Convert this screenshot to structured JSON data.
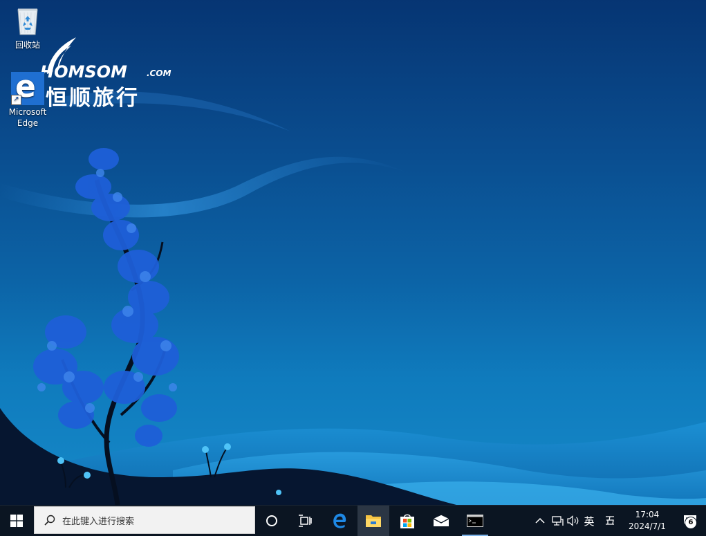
{
  "desktop": {
    "icons": [
      {
        "label": "回收站",
        "icon": "recycle-bin-icon"
      },
      {
        "label": "Microsoft Edge",
        "label_line1": "Microsoft",
        "label_line2": "Edge",
        "icon": "edge-icon"
      }
    ]
  },
  "wallpaper": {
    "brand_en": "HOMSOM",
    "brand_com": ".COM",
    "brand_cn": "恒顺旅行"
  },
  "taskbar": {
    "search_placeholder": "在此键入进行搜索",
    "pinned": [
      "cortana-icon",
      "task-view-icon",
      "edge-icon",
      "file-explorer-icon",
      "store-icon",
      "mail-icon",
      "command-prompt-icon"
    ],
    "active_app": "command-prompt-icon",
    "tray": {
      "language": "英",
      "ime_icon": "ime-mode-icon",
      "time": "17:04",
      "date": "2024/7/1",
      "notification_count": "6"
    }
  },
  "colors": {
    "taskbar_bg": "#0b1522",
    "wallpaper_top": "#063573",
    "wallpaper_bottom": "#1689c8",
    "tree_leaves": "#1e5fd8",
    "accent": "#7eb4ea"
  }
}
